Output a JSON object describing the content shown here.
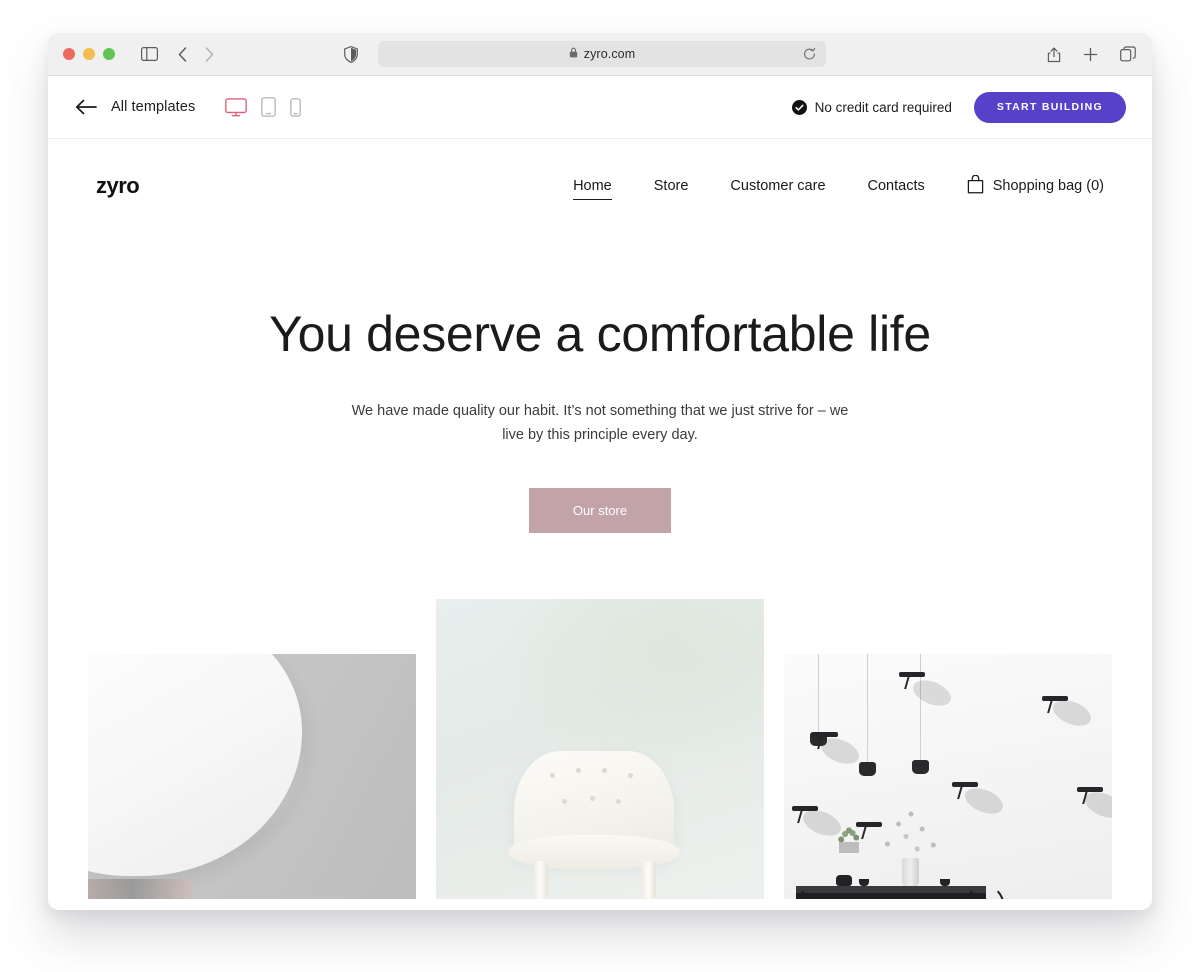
{
  "browser": {
    "traffic_lights": [
      "close",
      "minimize",
      "zoom"
    ],
    "url": "zyro.com",
    "lock_icon": "lock-icon",
    "sidebar_icon": "sidebar-toggle-icon",
    "back_icon": "nav-back-icon",
    "forward_icon": "nav-forward-icon",
    "shield_icon": "privacy-shield-icon",
    "reload_icon": "reload-icon",
    "share_icon": "share-icon",
    "new_tab_icon": "plus-icon",
    "tabs_icon": "tab-overview-icon"
  },
  "editor_bar": {
    "back_label": "back-arrow",
    "all_templates": "All templates",
    "devices": [
      {
        "name": "desktop",
        "icon": "desktop-icon",
        "active": true
      },
      {
        "name": "tablet",
        "icon": "tablet-icon",
        "active": false
      },
      {
        "name": "mobile",
        "icon": "mobile-icon",
        "active": false
      }
    ],
    "no_credit_card": "No credit card required",
    "check_icon": "check-circle-icon",
    "start_building": "START BUILDING",
    "accent_purple": "#5641c8",
    "device_active_color": "#e0617c"
  },
  "site": {
    "logo": "zyro",
    "nav": [
      {
        "label": "Home",
        "active": true
      },
      {
        "label": "Store",
        "active": false
      },
      {
        "label": "Customer care",
        "active": false
      },
      {
        "label": "Contacts",
        "active": false
      }
    ],
    "shopping_bag": {
      "icon": "shopping-bag-icon",
      "label": "Shopping bag (0)",
      "count": 0
    },
    "hero": {
      "title": "You deserve a comfortable life",
      "subtitle": "We have made quality our habit. It’s not something that we just strive for – we live by this principle every day.",
      "cta_label": "Our store",
      "cta_color": "#c1a3a8"
    },
    "gallery": [
      {
        "name": "white-molded-chair-photo",
        "alt": "White molded chair on gray background"
      },
      {
        "name": "white-tufted-armchair-photo",
        "alt": "White tufted armchair on pale mint background"
      },
      {
        "name": "dining-room-pendant-lamps-photo",
        "alt": "Dining room with black pendant lamps and wall shelves"
      }
    ]
  }
}
